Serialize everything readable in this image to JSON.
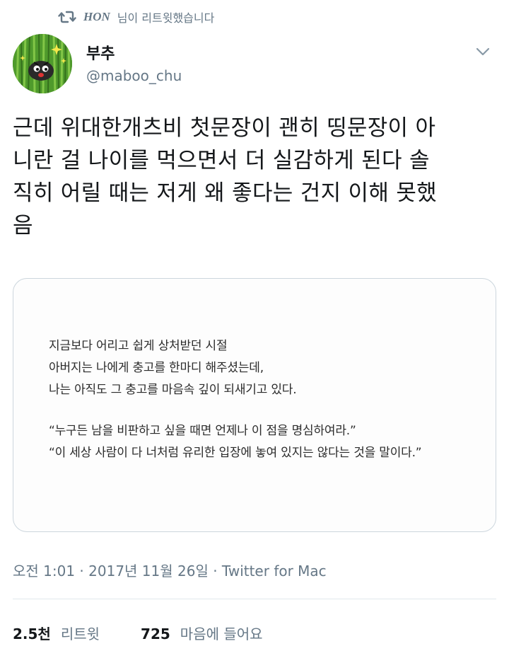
{
  "retweet_header": {
    "user": "HON",
    "text": "님이 리트윗했습니다"
  },
  "author": {
    "name": "부추",
    "handle": "@maboo_chu"
  },
  "tweet": {
    "lines": [
      "근데  위대한개츠비 첫문장이 괜히 띵문장이 아",
      "니란 걸 나이를 먹으면서 더 실감하게 된다  솔",
      "직히 어릴 때는 저게 왜 좋다는 건지 이해 못했",
      "음"
    ]
  },
  "card": {
    "lines": [
      "지금보다 어리고 쉽게 상처받던 시절",
      "아버지는 나에게 충고를 한마디 해주셨는데,",
      "나는 아직도 그 충고를 마음속 깊이 되새기고 있다.",
      "“누구든 남을 비판하고 싶을 때면 언제나 이 점을 명심하여라.”",
      "“이 세상 사람이 다 너처럼 유리한 입장에 놓여 있지는 않다는 것을 말이다.”"
    ]
  },
  "meta": {
    "timestamp": "오전 1:01 · 2017년 11월 26일 · Twitter for Mac"
  },
  "stats": {
    "retweets_count": "2.5천",
    "retweets_label": "리트윗",
    "likes_count": "725",
    "likes_label": "마음에 들어요"
  },
  "colors": {
    "text": "#14171a",
    "secondary": "#657786",
    "border": "#ccd6dd"
  }
}
